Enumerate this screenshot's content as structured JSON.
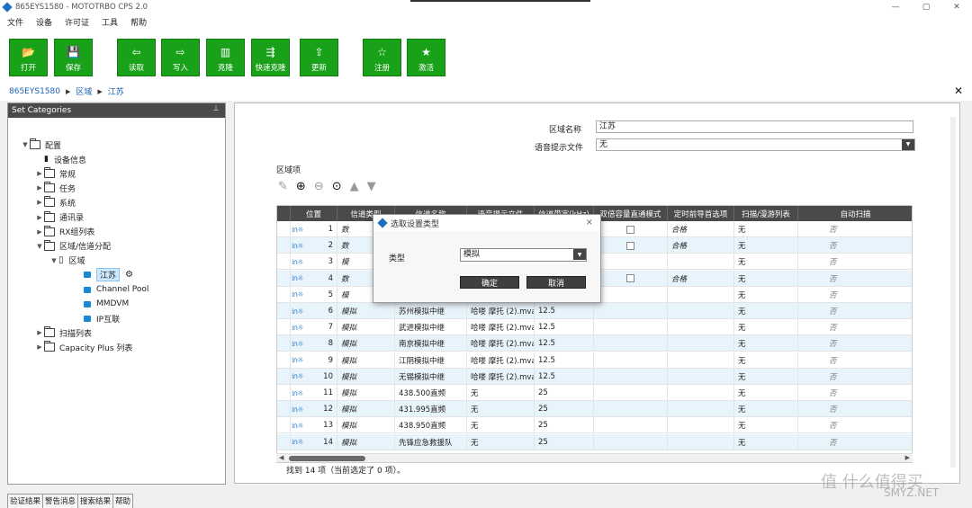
{
  "window": {
    "title": "865EYS1580 - MOTOTRBO CPS 2.0",
    "min": "—",
    "max": "▢",
    "close": "✕"
  },
  "menu": [
    "文件",
    "设备",
    "许可证",
    "工具",
    "帮助"
  ],
  "toolbar": [
    {
      "label": "打开",
      "icon": "folder-icon",
      "glyph": "📂"
    },
    {
      "label": "保存",
      "icon": "save-icon",
      "glyph": "💾"
    },
    {
      "label": "读取",
      "icon": "read-icon",
      "glyph": "⇦"
    },
    {
      "label": "写入",
      "icon": "write-icon",
      "glyph": "⇨"
    },
    {
      "label": "克隆",
      "icon": "clone-icon",
      "glyph": "▥"
    },
    {
      "label": "快速克隆",
      "icon": "fast-clone-icon",
      "glyph": "⇶"
    },
    {
      "label": "更新",
      "icon": "update-icon",
      "glyph": "⇧"
    },
    {
      "label": "注册",
      "icon": "star-icon",
      "glyph": "☆"
    },
    {
      "label": "激活",
      "icon": "activate-icon",
      "glyph": "★"
    }
  ],
  "breadcrumb": [
    "865EYS1580",
    "区域",
    "江苏"
  ],
  "left_panel": {
    "title": "Set Categories",
    "tree": [
      {
        "label": "配置",
        "level": 0,
        "expanded": true,
        "type": "root"
      },
      {
        "label": "设备信息",
        "level": 1,
        "type": "device"
      },
      {
        "label": "常规",
        "level": 1,
        "type": "folder"
      },
      {
        "label": "任务",
        "level": 1,
        "type": "folder"
      },
      {
        "label": "系统",
        "level": 1,
        "type": "folder"
      },
      {
        "label": "通讯录",
        "level": 1,
        "type": "folder"
      },
      {
        "label": "RX组列表",
        "level": 1,
        "type": "folder"
      },
      {
        "label": "区域/信道分配",
        "level": 1,
        "type": "folder",
        "expanded": true
      },
      {
        "label": "区域",
        "level": 2,
        "type": "doc",
        "expanded": true
      },
      {
        "label": "江苏",
        "level": 3,
        "type": "blue",
        "selected": true
      },
      {
        "label": "Channel Pool",
        "level": 3,
        "type": "blue"
      },
      {
        "label": "MMDVM",
        "level": 3,
        "type": "blue"
      },
      {
        "label": "IP互联",
        "level": 3,
        "type": "blue"
      },
      {
        "label": "扫描列表",
        "level": 1,
        "type": "folder"
      },
      {
        "label": "Capacity Plus 列表",
        "level": 1,
        "type": "folder"
      }
    ]
  },
  "bottom_tabs": [
    "验证结果",
    "警告消息",
    "搜索结果",
    "帮助"
  ],
  "form": {
    "zone_name_label": "区域名称",
    "zone_name_value": "江苏",
    "voice_file_label": "语音提示文件",
    "voice_file_value": "无",
    "items_label": "区域项"
  },
  "table": {
    "headers": [
      "位置",
      "信道类型",
      "信道名称",
      "语音提示文件",
      "信道带宽(kHz)",
      "双倍容量直通模式",
      "定时前导首选项",
      "扫描/漫游列表",
      "自动扫描"
    ],
    "rows": [
      {
        "pos": "1",
        "type": "数",
        "name": "",
        "voice": "",
        "bw": "",
        "dcdm": true,
        "pref": "合格",
        "scan": "无",
        "auto": "否"
      },
      {
        "pos": "2",
        "type": "数",
        "name": "",
        "voice": "",
        "bw": "",
        "dcdm": true,
        "pref": "合格",
        "scan": "无",
        "auto": "否"
      },
      {
        "pos": "3",
        "type": "模",
        "name": "",
        "voice": "",
        "bw": "",
        "dcdm": false,
        "pref": "",
        "scan": "无",
        "auto": "否"
      },
      {
        "pos": "4",
        "type": "数",
        "name": "",
        "voice": "",
        "bw": "",
        "dcdm": true,
        "pref": "合格",
        "scan": "无",
        "auto": "否"
      },
      {
        "pos": "5",
        "type": "模",
        "name": "",
        "voice": "",
        "bw": "",
        "dcdm": false,
        "pref": "",
        "scan": "无",
        "auto": "否"
      },
      {
        "pos": "6",
        "type": "模拟",
        "name": "苏州模拟中继",
        "voice": "哈喽 摩托 (2).mva",
        "bw": "12.5",
        "dcdm": false,
        "pref": "",
        "scan": "无",
        "auto": "否"
      },
      {
        "pos": "7",
        "type": "模拟",
        "name": "武进模拟中继",
        "voice": "哈喽 摩托 (2).mva",
        "bw": "12.5",
        "dcdm": false,
        "pref": "",
        "scan": "无",
        "auto": "否"
      },
      {
        "pos": "8",
        "type": "模拟",
        "name": "南京模拟中继",
        "voice": "哈喽 摩托 (2).mva",
        "bw": "12.5",
        "dcdm": false,
        "pref": "",
        "scan": "无",
        "auto": "否"
      },
      {
        "pos": "9",
        "type": "模拟",
        "name": "江阴模拟中继",
        "voice": "哈喽 摩托 (2).mva",
        "bw": "12.5",
        "dcdm": false,
        "pref": "",
        "scan": "无",
        "auto": "否"
      },
      {
        "pos": "10",
        "type": "模拟",
        "name": "无锡模拟中继",
        "voice": "哈喽 摩托 (2).mva",
        "bw": "12.5",
        "dcdm": false,
        "pref": "",
        "scan": "无",
        "auto": "否"
      },
      {
        "pos": "11",
        "type": "模拟",
        "name": "438.500直频",
        "voice": "无",
        "bw": "25",
        "dcdm": false,
        "pref": "",
        "scan": "无",
        "auto": "否"
      },
      {
        "pos": "12",
        "type": "模拟",
        "name": "431.995直频",
        "voice": "无",
        "bw": "25",
        "dcdm": false,
        "pref": "",
        "scan": "无",
        "auto": "否"
      },
      {
        "pos": "13",
        "type": "模拟",
        "name": "438.950直频",
        "voice": "无",
        "bw": "25",
        "dcdm": false,
        "pref": "",
        "scan": "无",
        "auto": "否"
      },
      {
        "pos": "14",
        "type": "模拟",
        "name": "先锋应急救援队",
        "voice": "无",
        "bw": "25",
        "dcdm": false,
        "pref": "",
        "scan": "无",
        "auto": "否"
      }
    ],
    "status": "找到 14 项（当前选定了 0 项）。"
  },
  "dialog": {
    "title": "选取设置类型",
    "type_label": "类型",
    "type_value": "模拟",
    "ok": "确定",
    "cancel": "取消",
    "close": "×"
  },
  "watermark": {
    "brand": "值 什么值得买",
    "site": "SMYZ.NET"
  }
}
